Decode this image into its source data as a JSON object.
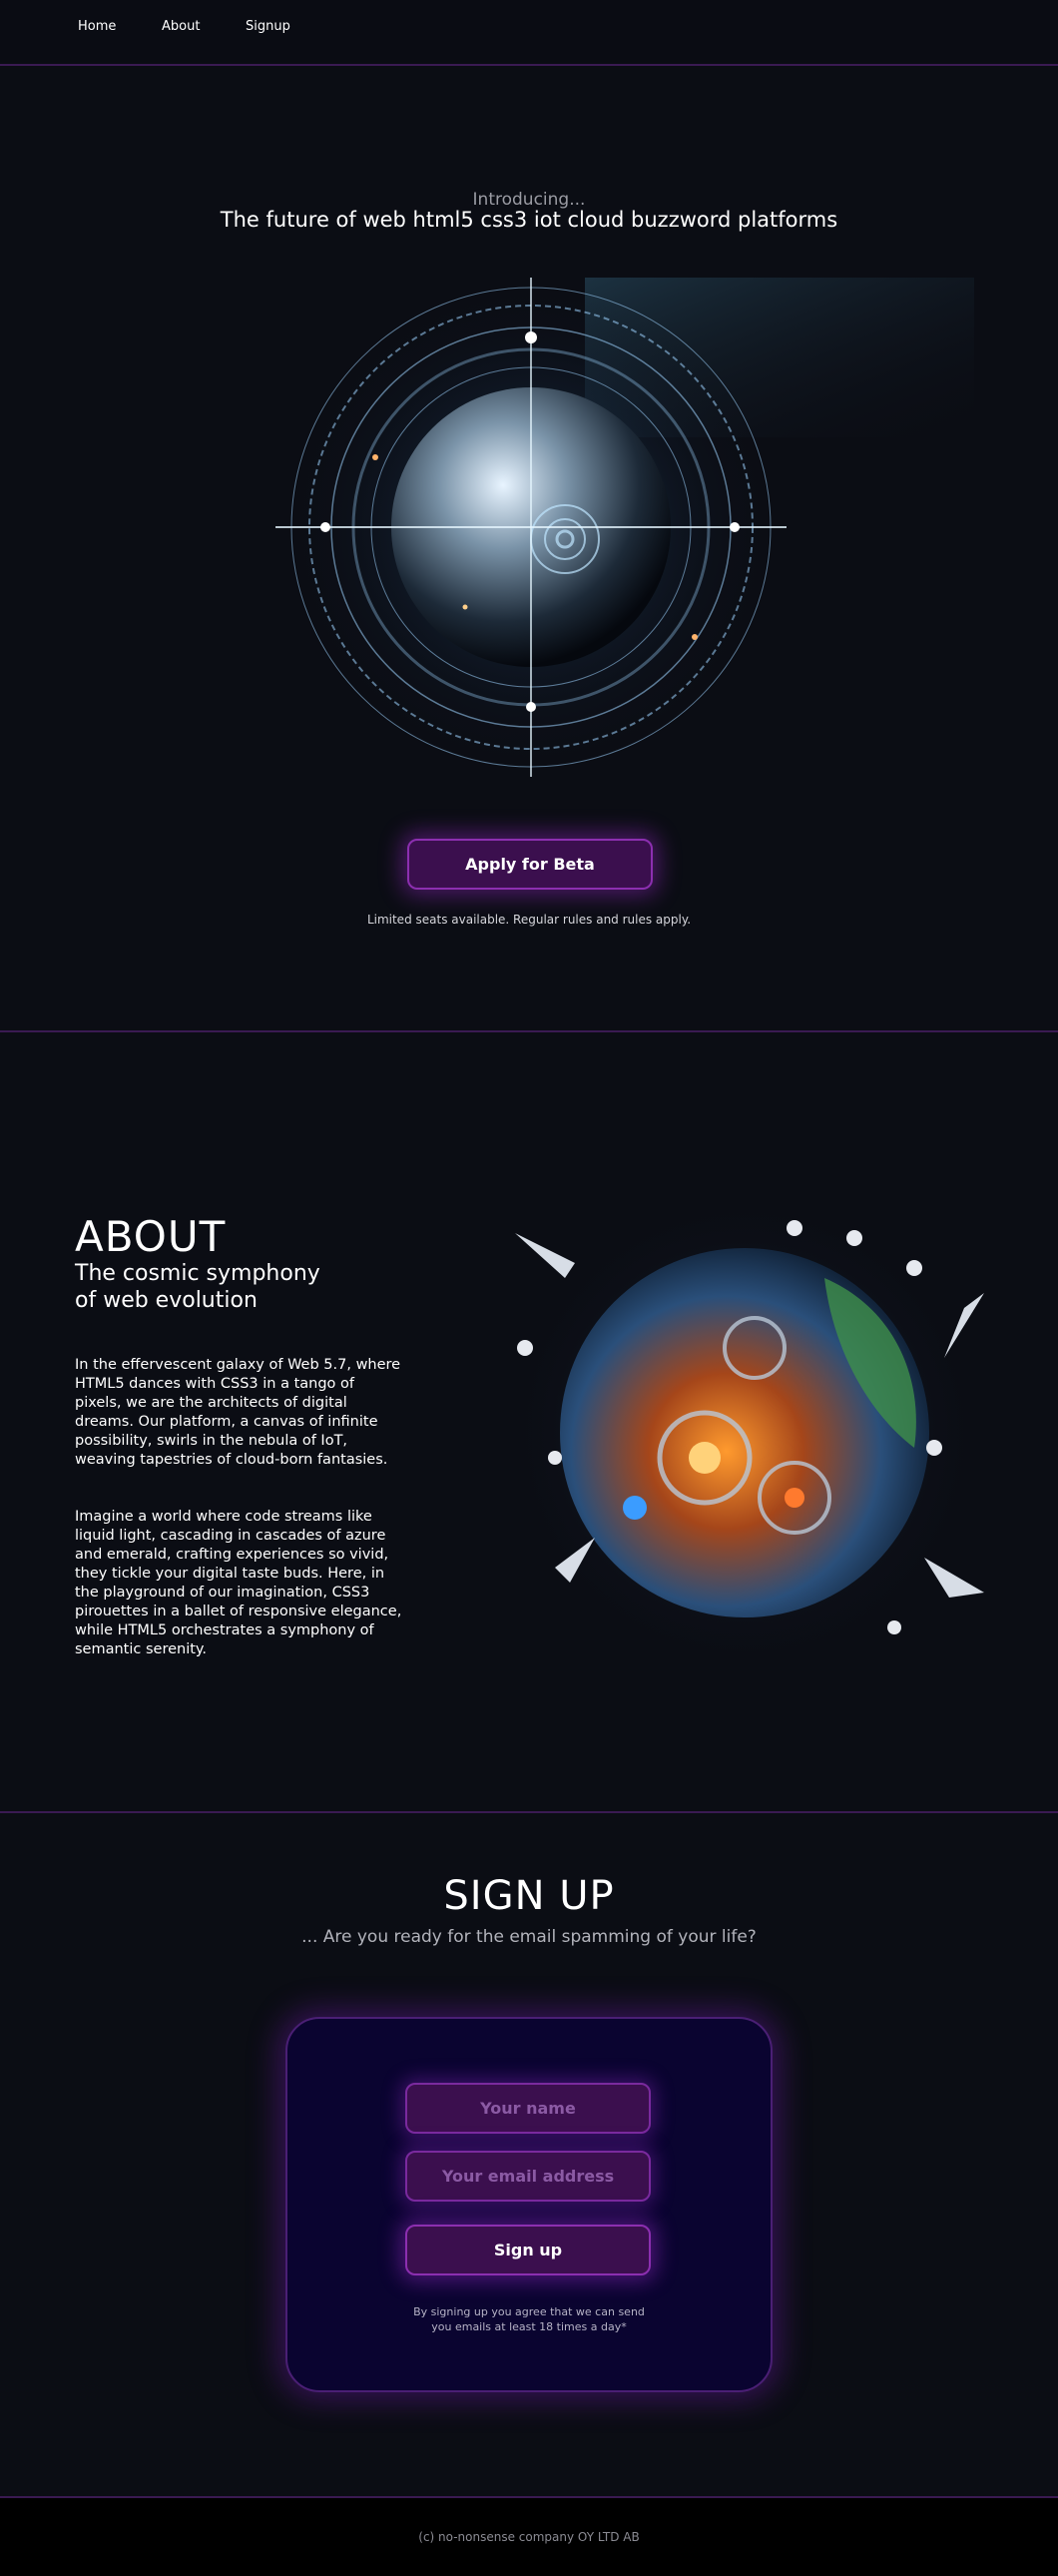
{
  "nav": {
    "items": [
      {
        "label": "Home"
      },
      {
        "label": "About"
      },
      {
        "label": "Signup"
      }
    ]
  },
  "hero": {
    "intro": "Introducing...",
    "title": "The future of web html5 css3 iot cloud buzzword platforms",
    "cta_label": "Apply for Beta",
    "note": "Limited seats available. Regular rules and rules apply."
  },
  "about": {
    "title": "ABOUT",
    "subtitle_line1": "The cosmic symphony",
    "subtitle_line2": "of web evolution",
    "paragraph1": "In the effervescent galaxy of Web 5.7, where HTML5 dances with CSS3 in a tango of pixels, we are the architects of digital dreams. Our platform, a canvas of infinite possibility, swirls in the nebula of IoT, weaving tapestries of cloud-born fantasies.",
    "paragraph2": "Imagine a world where code streams like liquid light, cascading in cascades of azure and emerald, crafting experiences so vivid, they tickle your digital taste buds. Here, in the playground of our imagination, CSS3 pirouettes in a ballet of responsive elegance, while HTML5 orchestrates a symphony of semantic serenity."
  },
  "signup": {
    "title": "SIGN UP",
    "subtitle": "... Are you ready for the email spamming of your life?",
    "name_placeholder": "Your name",
    "email_placeholder": "Your email address",
    "button_label": "Sign up",
    "note_line1": "By signing up you agree that we can send",
    "note_line2": "you emails at least 18 times a day*"
  },
  "footer": {
    "text": "(c) no-nonsense company OY LTD AB"
  },
  "colors": {
    "background": "#0b0d14",
    "accent": "#8c2fb0",
    "button_fill": "#3b0f4e",
    "card_fill": "#0a0430",
    "divider": "#3a1a52"
  }
}
